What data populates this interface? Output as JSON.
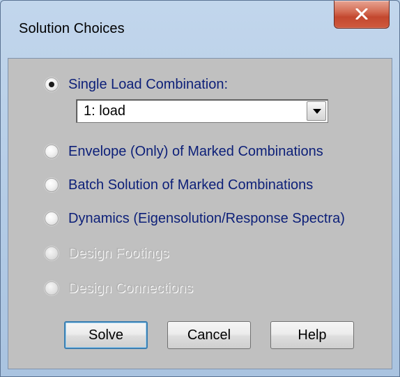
{
  "window": {
    "title": "Solution Choices",
    "close_icon": "close-icon"
  },
  "options": [
    {
      "label": "Single Load Combination:",
      "checked": true,
      "enabled": true
    },
    {
      "label": "Envelope (Only) of Marked Combinations",
      "checked": false,
      "enabled": true
    },
    {
      "label": "Batch Solution of Marked Combinations",
      "checked": false,
      "enabled": true
    },
    {
      "label": "Dynamics (Eigensolution/Response Spectra)",
      "checked": false,
      "enabled": true
    },
    {
      "label": "Design Footings",
      "checked": false,
      "enabled": false
    },
    {
      "label": "Design Connections",
      "checked": false,
      "enabled": false
    }
  ],
  "combination_select": {
    "value": "1: load",
    "arrow_icon": "dropdown-arrow-icon"
  },
  "buttons": {
    "solve": "Solve",
    "cancel": "Cancel",
    "help": "Help"
  },
  "colors": {
    "option_text": "#0c1f78",
    "disabled_text": "#b3b3b3",
    "dialog_face": "#c0c0c0",
    "close_button": "#c3482f"
  }
}
